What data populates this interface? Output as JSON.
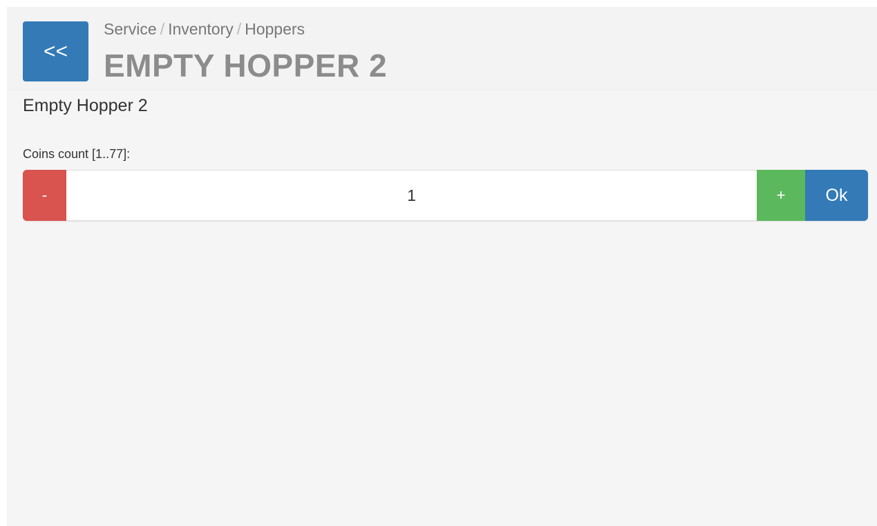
{
  "header": {
    "back_label": "<<",
    "breadcrumb": [
      "Service",
      "Inventory",
      "Hoppers"
    ],
    "breadcrumb_separator": "/",
    "title": "EMPTY HOPPER 2"
  },
  "main": {
    "subtitle": "Empty Hopper 2",
    "coins_label": "Coins count [1..77]:",
    "stepper": {
      "minus_label": "-",
      "value": "1",
      "plus_label": "+",
      "ok_label": "Ok"
    }
  },
  "colors": {
    "primary": "#337ab7",
    "danger": "#d9534f",
    "success": "#5cb85c",
    "background": "#f5f5f5",
    "title_gray": "#8c8c8c"
  }
}
